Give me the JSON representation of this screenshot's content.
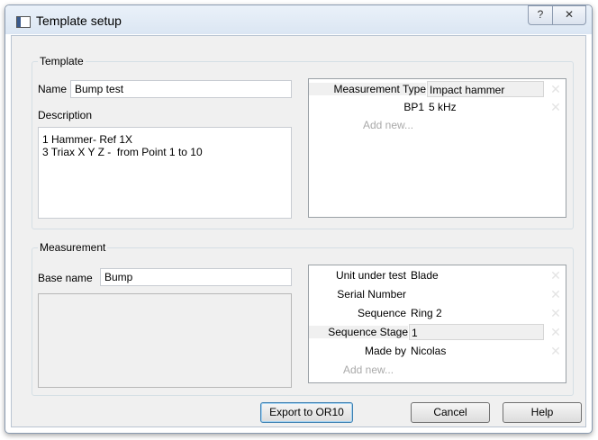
{
  "window": {
    "title": "Template setup",
    "help_glyph": "?",
    "close_glyph": "✕"
  },
  "template_group": {
    "title": "Template",
    "name_label": "Name",
    "name_value": "Bump test",
    "description_label": "Description",
    "description_value": "1 Hammer- Ref 1X\n3 Triax X Y Z -  from Point 1 to 10",
    "properties": [
      {
        "key": "Measurement Type",
        "value": "Impact hammer"
      },
      {
        "key": "BP1",
        "value": "5 kHz"
      }
    ],
    "add_new": "Add new..."
  },
  "measurement_group": {
    "title": "Measurement",
    "base_name_label": "Base name",
    "base_name_value": "Bump",
    "properties": [
      {
        "key": "Unit under test",
        "value": "Blade"
      },
      {
        "key": "Serial Number",
        "value": ""
      },
      {
        "key": "Sequence",
        "value": "Ring 2"
      },
      {
        "key": "Sequence Stage",
        "value": "1"
      },
      {
        "key": "Made by",
        "value": "Nicolas"
      }
    ],
    "add_new": "Add new..."
  },
  "buttons": {
    "export": "Export to OR10",
    "cancel": "Cancel",
    "help": "Help"
  },
  "icons": {
    "remove": "✕"
  }
}
